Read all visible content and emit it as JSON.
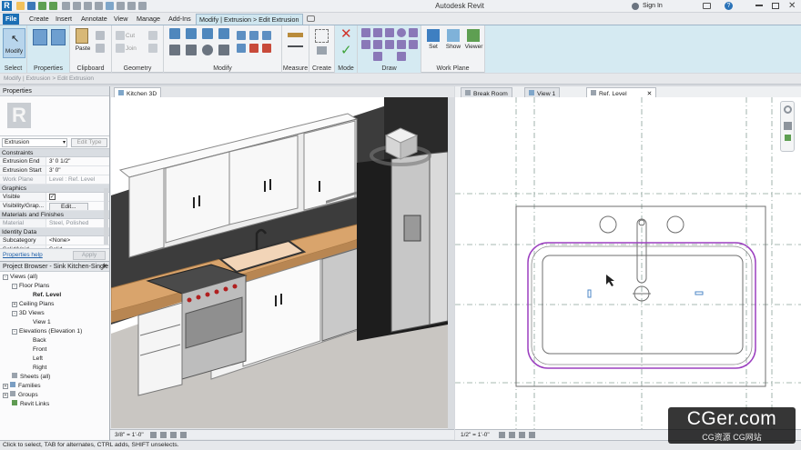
{
  "app": {
    "title": "Autodesk Revit",
    "sign_in": "Sign In"
  },
  "tabs": [
    "File",
    "Create",
    "Insert",
    "Annotate",
    "View",
    "Manage",
    "Add-Ins",
    "Modify | Extrusion > Edit Extrusion"
  ],
  "ribbon": {
    "modify_label": "Modify",
    "paste_label": "Paste",
    "cut_label": "Cut",
    "join_label": "Join",
    "set_label": "Set",
    "show_label": "Show",
    "viewer_label": "Viewer",
    "panels": [
      "Select",
      "Properties",
      "Clipboard",
      "Geometry",
      "Modify",
      "Measure",
      "Create",
      "Mode",
      "Draw",
      "Work Plane"
    ]
  },
  "options_bar": "Modify | Extrusion > Edit Extrusion",
  "properties": {
    "title": "Properties",
    "type_selector": "Extrusion",
    "edit_type": "Edit Type",
    "groups": {
      "constraints": "Constraints",
      "graphics": "Graphics",
      "materials": "Materials and Finishes",
      "identity": "Identity Data"
    },
    "rows": {
      "extrusion_end": {
        "k": "Extrusion End",
        "v": "3'  0 1/2\""
      },
      "extrusion_start": {
        "k": "Extrusion Start",
        "v": "3'  0\""
      },
      "work_plane": {
        "k": "Work Plane",
        "v": "Level : Ref. Level"
      },
      "visible": {
        "k": "Visible",
        "v": ""
      },
      "visibility": {
        "k": "Visibility/Grap...",
        "v": "Edit..."
      },
      "material": {
        "k": "Material",
        "v": "Steel, Polished"
      },
      "subcategory": {
        "k": "Subcategory",
        "v": "<None>"
      },
      "solid_void": {
        "k": "Solid/Void",
        "v": "Solid"
      }
    },
    "help_link": "Properties help",
    "apply": "Apply"
  },
  "browser": {
    "title": "Project Browser - Sink Kitchen-Single",
    "nodes": {
      "views": "Views (all)",
      "floor_plans": "Floor Plans",
      "ref_level": "Ref. Level",
      "ceiling_plans": "Ceiling Plans",
      "views_3d": "3D Views",
      "view1": "View 1",
      "elevations": "Elevations (Elevation 1)",
      "back": "Back",
      "front": "Front",
      "left": "Left",
      "right": "Right",
      "sheets": "Sheets (all)",
      "families": "Families",
      "groups": "Groups",
      "links": "Revit Links"
    }
  },
  "views": {
    "kitchen_tab": "Kitchen 3D",
    "break_room_tab": "Break Room",
    "view1_tab": "View 1",
    "ref_level_tab": "Ref. Level",
    "left_scale": "3/8\" = 1'-0\"",
    "right_scale": "1/2\" = 1'-0\""
  },
  "status": "Click to select, TAB for alternates, CTRL adds, SHIFT unselects.",
  "watermark": {
    "main": "CGer.com",
    "sub": "CG资源 CG网站"
  },
  "colors": {
    "file_tab": "#1b6fb5",
    "contextual_tab": "#cfe6ef",
    "sketch_line": "#9b3fbf",
    "reference_plane": "#7a8c86"
  }
}
